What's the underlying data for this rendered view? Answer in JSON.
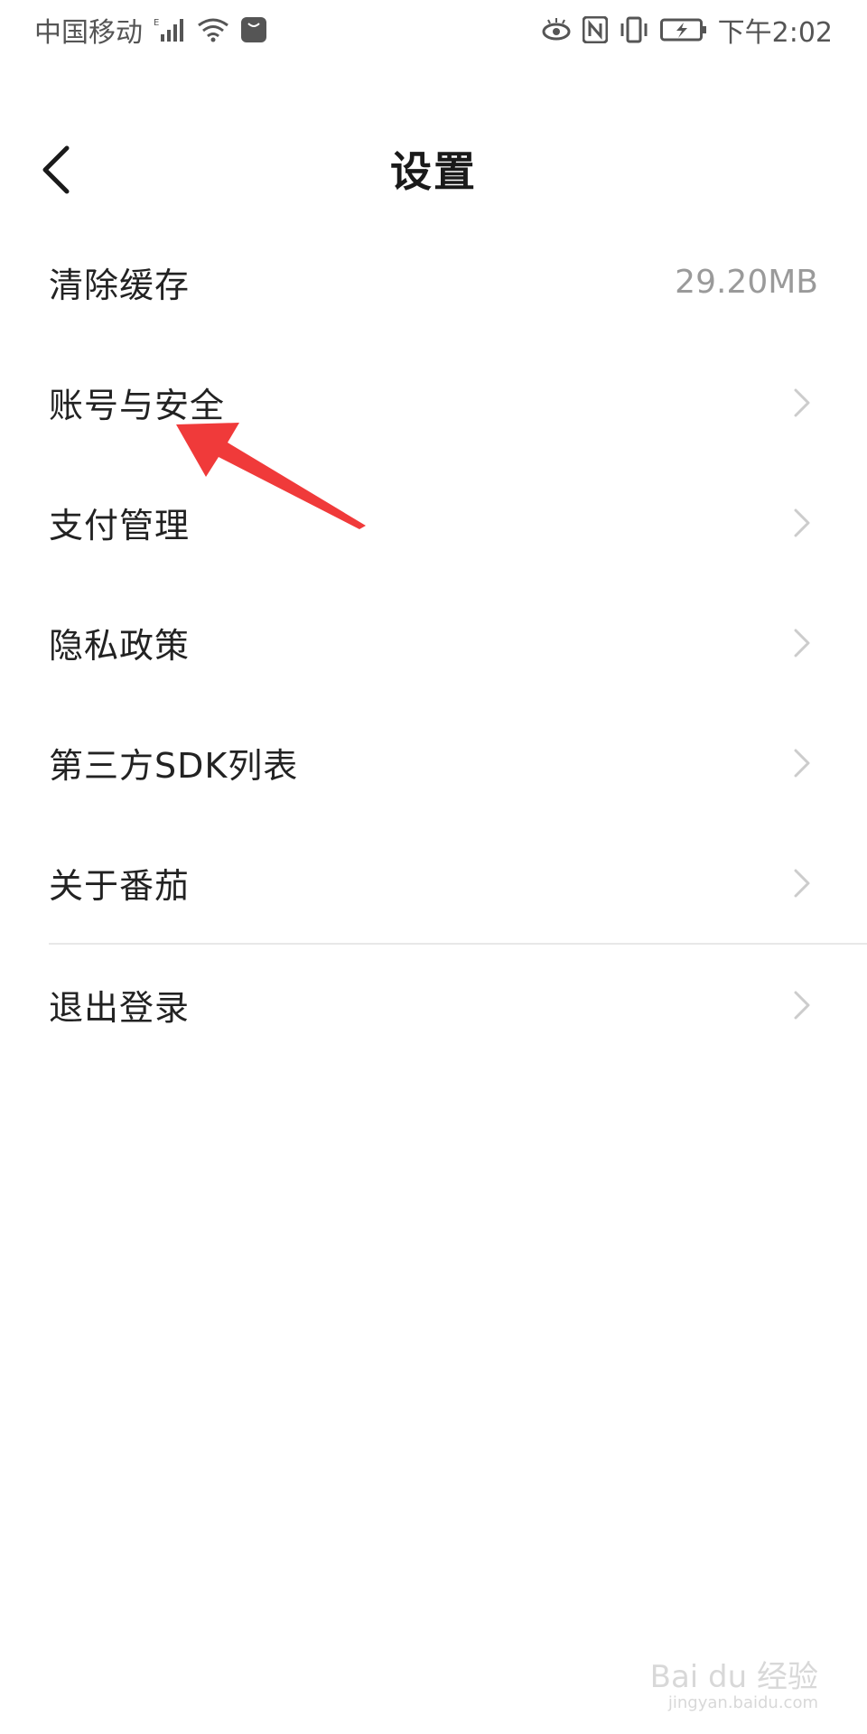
{
  "status_bar": {
    "carrier": "中国移动",
    "time": "下午2:02"
  },
  "header": {
    "title": "设置"
  },
  "settings": {
    "items": [
      {
        "label": "清除缓存",
        "value": "29.20MB"
      },
      {
        "label": "账号与安全"
      },
      {
        "label": "支付管理"
      },
      {
        "label": "隐私政策"
      },
      {
        "label": "第三方SDK列表"
      },
      {
        "label": "关于番茄"
      },
      {
        "label": "退出登录"
      }
    ]
  },
  "watermark": {
    "brand": "Bai du 经验",
    "url": "jingyan.baidu.com"
  },
  "colors": {
    "arrow": "#f03a3a",
    "chevron": "#cccccc",
    "value_text": "#9a9a9a"
  }
}
